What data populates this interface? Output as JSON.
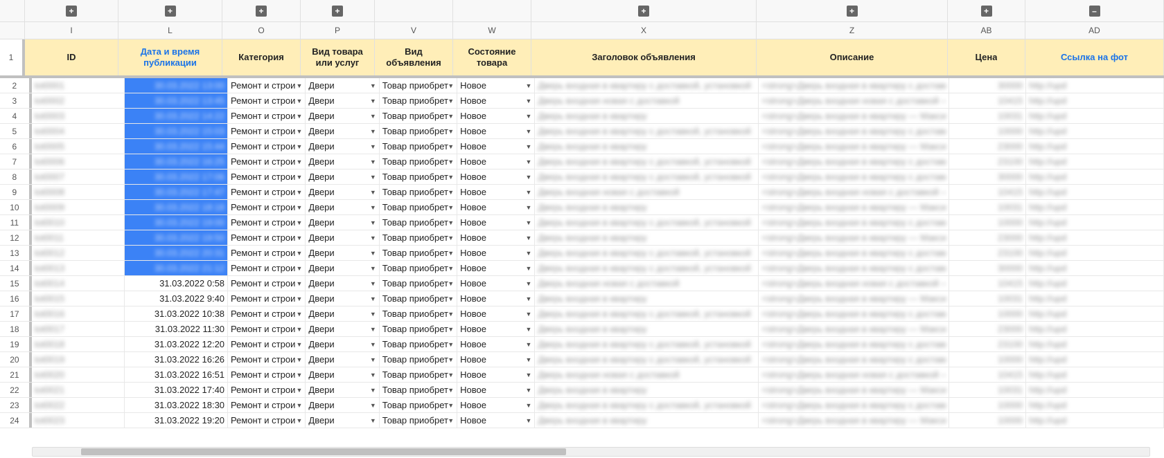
{
  "columns": {
    "letters": [
      "I",
      "L",
      "O",
      "P",
      "V",
      "W",
      "X",
      "Z",
      "AB",
      "AD"
    ],
    "tool_icons": [
      "plus",
      "plus",
      "plus",
      "plus",
      "",
      "",
      "plus",
      "plus",
      "plus",
      "minus"
    ],
    "headers": [
      "ID",
      "Дата и время публикации",
      "Категория",
      "Вид товара или услуг",
      "Вид объявления",
      "Состояние товара",
      "Заголовок объявления",
      "Описание",
      "Цена",
      "Ссылка на фот"
    ]
  },
  "constant_values": {
    "category": "Ремонт и строи",
    "product": "Двери",
    "listing": "Товар приобрет",
    "condition": "Новое"
  },
  "selected_rows_until": 13,
  "rows": [
    {
      "n": 1,
      "id": "tot0001",
      "date": "30.03.2022 13:00",
      "title": "Дверь входная в квартиру с доставкой, установкой",
      "desc": "<strong>Дверь входная в квартиру с доставкой,",
      "price": "30000",
      "link": "http://upd"
    },
    {
      "n": 2,
      "id": "tot0002",
      "date": "30.03.2022 13:45",
      "title": "Дверь входная новая с доставкой",
      "desc": "<strong>Дверь входная новая с доставкой — На",
      "price": "10415",
      "link": "http://upd"
    },
    {
      "n": 3,
      "id": "tot0003",
      "date": "30.03.2022 14:22",
      "title": "Дверь входная в квартиру",
      "desc": "<strong>Дверь входная в квартиру — Максим до",
      "price": "10031",
      "link": "http://upd"
    },
    {
      "n": 4,
      "id": "tot0004",
      "date": "30.03.2022 15:03",
      "title": "Дверь входная в квартиру с доставкой, установкой",
      "desc": "<strong>Дверь входная в квартиру с доставкой,",
      "price": "10000",
      "link": "http://upd"
    },
    {
      "n": 5,
      "id": "tot0005",
      "date": "30.03.2022 15:44",
      "title": "Дверь входная в квартиру",
      "desc": "<strong>Дверь входная в квартиру — Максим до",
      "price": "23000",
      "link": "http://upd"
    },
    {
      "n": 6,
      "id": "tot0006",
      "date": "30.03.2022 16:25",
      "title": "Дверь входная в квартиру с доставкой, установкой",
      "desc": "<strong>Дверь входная в квартиру с доставкой,",
      "price": "23100",
      "link": "http://upd"
    },
    {
      "n": 7,
      "id": "tot0007",
      "date": "30.03.2022 17:06",
      "title": "Дверь входная в квартиру с доставкой, установкой",
      "desc": "<strong>Дверь входная в квартиру с доставкой,",
      "price": "30000",
      "link": "http://upd"
    },
    {
      "n": 8,
      "id": "tot0008",
      "date": "30.03.2022 17:47",
      "title": "Дверь входная новая с доставкой",
      "desc": "<strong>Дверь входная новая с доставкой — На",
      "price": "10415",
      "link": "http://upd"
    },
    {
      "n": 9,
      "id": "tot0009",
      "date": "30.03.2022 18:18",
      "title": "Дверь входная в квартиру",
      "desc": "<strong>Дверь входная в квартиру — Максим до",
      "price": "10031",
      "link": "http://upd"
    },
    {
      "n": 10,
      "id": "tot0010",
      "date": "30.03.2022 19:00",
      "title": "Дверь входная в квартиру с доставкой, установкой",
      "desc": "<strong>Дверь входная в квартиру с доставкой,",
      "price": "10000",
      "link": "http://upd"
    },
    {
      "n": 11,
      "id": "tot0011",
      "date": "30.03.2022 19:50",
      "title": "Дверь входная в квартиру",
      "desc": "<strong>Дверь входная в квартиру — Максим до",
      "price": "23000",
      "link": "http://upd"
    },
    {
      "n": 12,
      "id": "tot0012",
      "date": "30.03.2022 20:31",
      "title": "Дверь входная в квартиру с доставкой, установкой",
      "desc": "<strong>Дверь входная в квартиру с доставкой,",
      "price": "23100",
      "link": "http://upd"
    },
    {
      "n": 13,
      "id": "tot0013",
      "date": "30.03.2022 21:12",
      "title": "Дверь входная в квартиру с доставкой, установкой",
      "desc": "<strong>Дверь входная в квартиру с доставкой,",
      "price": "30000",
      "link": "http://upd"
    },
    {
      "n": 14,
      "id": "tot0014",
      "date": "31.03.2022 0:58",
      "title": "Дверь входная новая с доставкой",
      "desc": "<strong>Дверь входная новая с доставкой — На",
      "price": "10415",
      "link": "http://upd"
    },
    {
      "n": 15,
      "id": "tot0015",
      "date": "31.03.2022 9:40",
      "title": "Дверь входная в квартиру",
      "desc": "<strong>Дверь входная в квартиру — Максим до",
      "price": "10031",
      "link": "http://upd"
    },
    {
      "n": 16,
      "id": "tot0016",
      "date": "31.03.2022 10:38",
      "title": "Дверь входная в квартиру с доставкой, установкой",
      "desc": "<strong>Дверь входная в квартиру с доставкой,",
      "price": "10000",
      "link": "http://upd"
    },
    {
      "n": 17,
      "id": "tot0017",
      "date": "31.03.2022 11:30",
      "title": "Дверь входная в квартиру",
      "desc": "<strong>Дверь входная в квартиру — Максим до",
      "price": "23000",
      "link": "http://upd"
    },
    {
      "n": 18,
      "id": "tot0018",
      "date": "31.03.2022 12:20",
      "title": "Дверь входная в квартиру с доставкой, установкой",
      "desc": "<strong>Дверь входная в квартиру с доставкой,",
      "price": "23100",
      "link": "http://upd"
    },
    {
      "n": 19,
      "id": "tot0019",
      "date": "31.03.2022 16:26",
      "title": "Дверь входная в квартиру с доставкой, установкой",
      "desc": "<strong>Дверь входная в квартиру с доставкой,",
      "price": "10000",
      "link": "http://upd"
    },
    {
      "n": 20,
      "id": "tot0020",
      "date": "31.03.2022 16:51",
      "title": "Дверь входная новая с доставкой",
      "desc": "<strong>Дверь входная новая с доставкой — На",
      "price": "10415",
      "link": "http://upd"
    },
    {
      "n": 21,
      "id": "tot0021",
      "date": "31.03.2022 17:40",
      "title": "Дверь входная в квартиру",
      "desc": "<strong>Дверь входная в квартиру — Максим до",
      "price": "10031",
      "link": "http://upd"
    },
    {
      "n": 22,
      "id": "tot0022",
      "date": "31.03.2022 18:30",
      "title": "Дверь входная в квартиру с доставкой, установкой",
      "desc": "<strong>Дверь входная в квартиру с доставкой,",
      "price": "10000",
      "link": "http://upd"
    },
    {
      "n": 23,
      "id": "tot0023",
      "date": "31.03.2022 19:20",
      "title": "Дверь входная в квартиру",
      "desc": "<strong>Дверь входная в квартиру — Максим до",
      "price": "10000",
      "link": "http://upd"
    }
  ]
}
